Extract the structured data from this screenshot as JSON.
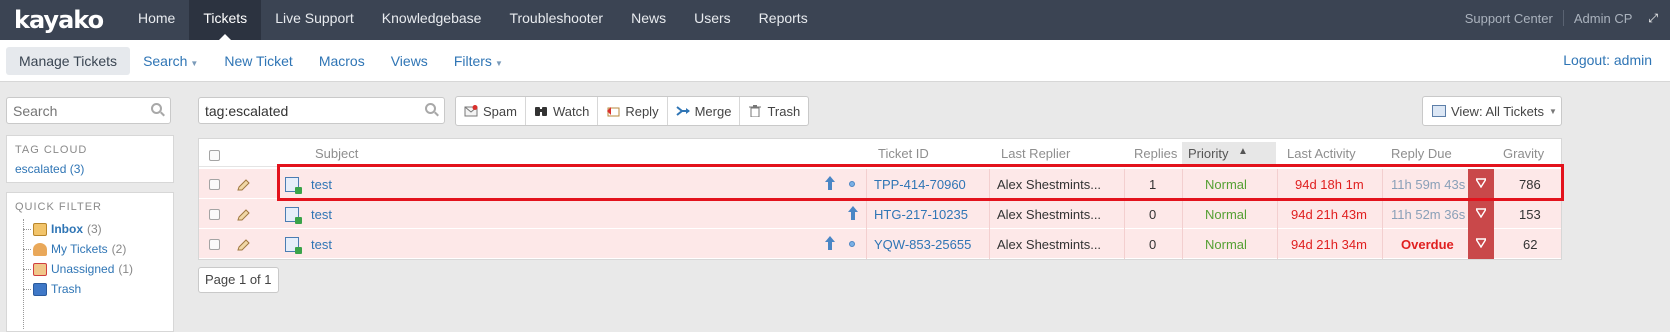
{
  "brand": {
    "logo": "kayako"
  },
  "nav": {
    "items": [
      {
        "label": "Home",
        "active": false
      },
      {
        "label": "Tickets",
        "active": true
      },
      {
        "label": "Live Support",
        "active": false
      },
      {
        "label": "Knowledgebase",
        "active": false
      },
      {
        "label": "Troubleshooter",
        "active": false
      },
      {
        "label": "News",
        "active": false
      },
      {
        "label": "Users",
        "active": false
      },
      {
        "label": "Reports",
        "active": false
      }
    ],
    "support_center": "Support Center",
    "admin_cp": "Admin CP"
  },
  "subnav": {
    "items": [
      {
        "label": "Manage Tickets",
        "active": true,
        "dropdown": false
      },
      {
        "label": "Search",
        "active": false,
        "dropdown": true
      },
      {
        "label": "New Ticket",
        "active": false,
        "dropdown": false
      },
      {
        "label": "Macros",
        "active": false,
        "dropdown": false
      },
      {
        "label": "Views",
        "active": false,
        "dropdown": false
      },
      {
        "label": "Filters",
        "active": false,
        "dropdown": true
      }
    ],
    "logout": "Logout: admin"
  },
  "sidebar": {
    "search_placeholder": "Search",
    "tag_cloud_title": "TAG CLOUD",
    "tag": "escalated (3)",
    "quick_filter_title": "QUICK FILTER",
    "quick_filters": [
      {
        "label": "Inbox",
        "count": "(3)",
        "icon": "inbox-icon"
      },
      {
        "label": "My Tickets",
        "count": "(2)",
        "icon": "user-icon"
      },
      {
        "label": "Unassigned",
        "count": "(1)",
        "icon": "unassigned-icon"
      },
      {
        "label": "Trash",
        "count": "",
        "icon": "trash-icon"
      }
    ]
  },
  "toolbar": {
    "search_value": "tag:escalated",
    "actions": [
      {
        "label": "Spam",
        "icon": "spam-icon"
      },
      {
        "label": "Watch",
        "icon": "binoculars-icon"
      },
      {
        "label": "Reply",
        "icon": "reply-icon"
      },
      {
        "label": "Merge",
        "icon": "merge-icon"
      },
      {
        "label": "Trash",
        "icon": "trash-icon"
      }
    ],
    "view": "View: All Tickets"
  },
  "table": {
    "headers": {
      "subject": "Subject",
      "ticket_id": "Ticket ID",
      "last_replier": "Last Replier",
      "replies": "Replies",
      "priority": "Priority",
      "last_activity": "Last Activity",
      "reply_due": "Reply Due",
      "gravity": "Gravity"
    },
    "rows": [
      {
        "subject": "test",
        "ticket_id": "TPP-414-70960",
        "last_replier": "Alex Shestmints...",
        "replies": "1",
        "priority": "Normal",
        "last_activity": "94d 18h 1m",
        "reply_due": "11h 59m 43s",
        "overdue": false,
        "gravity": "786",
        "dot": true
      },
      {
        "subject": "test",
        "ticket_id": "HTG-217-10235",
        "last_replier": "Alex Shestmints...",
        "replies": "0",
        "priority": "Normal",
        "last_activity": "94d 21h 43m",
        "reply_due": "11h 52m 36s",
        "overdue": false,
        "gravity": "153",
        "dot": false
      },
      {
        "subject": "test",
        "ticket_id": "YQW-853-25655",
        "last_replier": "Alex Shestmints...",
        "replies": "0",
        "priority": "Normal",
        "last_activity": "94d 21h 34m",
        "reply_due": "Overdue",
        "overdue": true,
        "gravity": "62",
        "dot": true
      }
    ],
    "pager": "Page 1 of 1"
  },
  "colors": {
    "topbar": "#3b4453",
    "link": "#2f75b5",
    "row_bg": "#fde8e8",
    "overdue": "#e02020",
    "priority_normal": "#55a033",
    "highlight": "#e3121c"
  }
}
